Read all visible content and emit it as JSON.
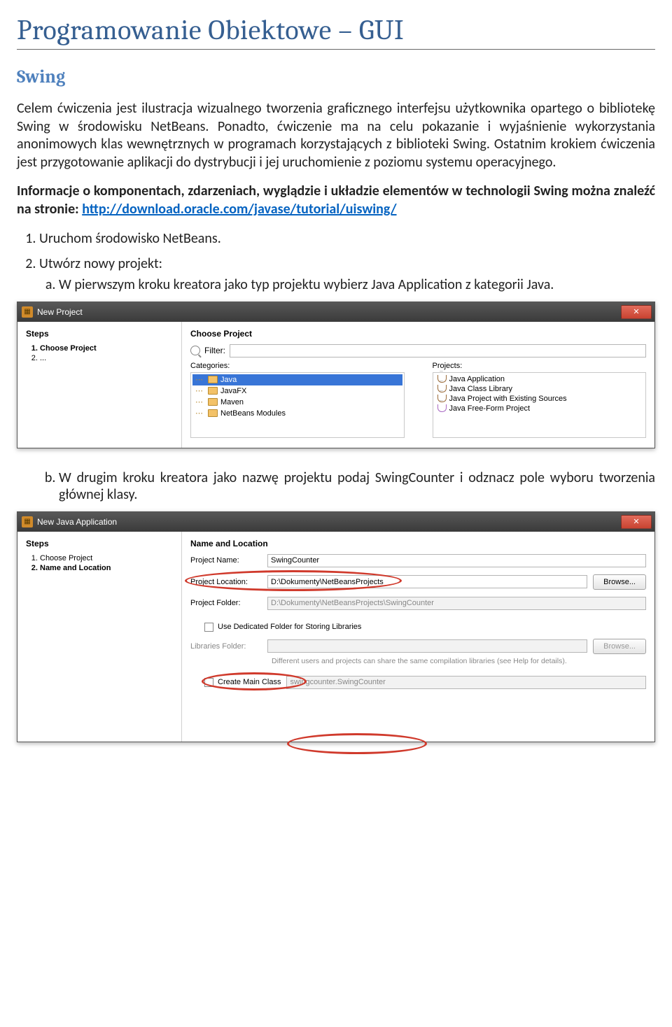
{
  "doc": {
    "title": "Programowanie Obiektowe – GUI",
    "subtitle": "Swing",
    "para1": "Celem ćwiczenia jest ilustracja wizualnego tworzenia graficznego interfejsu użytkownika opartego o bibliotekę Swing w środowisku NetBeans. Ponadto, ćwiczenie ma na celu pokazanie i wyjaśnienie wykorzystania anonimowych klas wewnętrznych w programach korzystających z biblioteki Swing. Ostatnim krokiem ćwiczenia jest przygotowanie aplikacji do dystrybucji i jej uruchomienie z poziomu systemu operacyjnego.",
    "para2a": "Informacje o komponentach, zdarzeniach, wyglądzie i układzie elementów w technologii Swing można znaleźć na stronie: ",
    "para2link": "http://download.oracle.com/javase/tutorial/uiswing/",
    "step1": "Uruchom środowisko NetBeans.",
    "step2": "Utwórz nowy projekt:",
    "step2a": "W pierwszym kroku kreatora jako typ projektu wybierz Java Application z kategorii Java.",
    "step2b": "W drugim kroku kreatora jako nazwę projektu podaj SwingCounter i odznacz pole wyboru tworzenia głównej klasy."
  },
  "d1": {
    "title": "New Project",
    "stepsHead": "Steps",
    "stepItems": [
      "Choose Project",
      "..."
    ],
    "rightHead": "Choose Project",
    "filterLabel": "Filter:",
    "catLabel": "Categories:",
    "projLabel": "Projects:",
    "categories": [
      "Java",
      "JavaFX",
      "Maven",
      "NetBeans Modules"
    ],
    "projects": [
      "Java Application",
      "Java Class Library",
      "Java Project with Existing Sources",
      "Java Free-Form Project"
    ]
  },
  "d2": {
    "title": "New Java Application",
    "stepsHead": "Steps",
    "stepItems": [
      "Choose Project",
      "Name and Location"
    ],
    "rightHead": "Name and Location",
    "projectName": {
      "label": "Project Name:",
      "value": "SwingCounter"
    },
    "projectLocation": {
      "label": "Project Location:",
      "value": "D:\\Dokumenty\\NetBeansProjects"
    },
    "projectFolder": {
      "label": "Project Folder:",
      "value": "D:\\Dokumenty\\NetBeansProjects\\SwingCounter"
    },
    "browse": "Browse...",
    "useDedicated": "Use Dedicated Folder for Storing Libraries",
    "libFolder": {
      "label": "Libraries Folder:",
      "value": ""
    },
    "helptext": "Different users and projects can share the same compilation libraries (see Help for details).",
    "createMain": {
      "label": "Create Main Class",
      "value": "swingcounter.SwingCounter"
    }
  }
}
